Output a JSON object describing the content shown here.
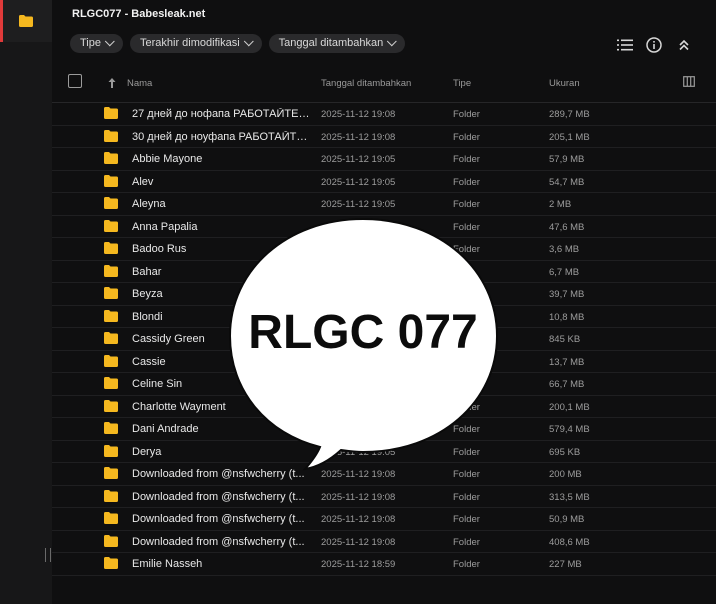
{
  "window": {
    "title": "RLGC077 - Babesleak.net"
  },
  "filters": [
    {
      "label": "Tipe"
    },
    {
      "label": "Terakhir dimodifikasi"
    },
    {
      "label": "Tanggal ditambahkan"
    }
  ],
  "toolbar_icons": [
    "list-view-icon",
    "info-icon",
    "collapse-icon"
  ],
  "table": {
    "columns": {
      "name": "Nama",
      "date": "Tanggal ditambahkan",
      "type": "Tipe",
      "size": "Ukuran"
    },
    "rows": [
      {
        "name": "27 дней до нофапа РАБОТАЙТЕ Б...",
        "date": "2025-11-12 19:08",
        "type": "Folder",
        "size": "289,7 MB"
      },
      {
        "name": "30 дней до ноуфапа РАБОТАЙТЕ ...",
        "date": "2025-11-12 19:08",
        "type": "Folder",
        "size": "205,1 MB"
      },
      {
        "name": "Abbie Mayone",
        "date": "2025-11-12 19:05",
        "type": "Folder",
        "size": "57,9 MB"
      },
      {
        "name": "Alev",
        "date": "2025-11-12 19:05",
        "type": "Folder",
        "size": "54,7 MB"
      },
      {
        "name": "Aleyna",
        "date": "2025-11-12 19:05",
        "type": "Folder",
        "size": "2 MB"
      },
      {
        "name": "Anna Papalia",
        "date": "",
        "type": "Folder",
        "size": "47,6 MB"
      },
      {
        "name": "Badoo Rus",
        "date": "",
        "type": "Folder",
        "size": "3,6 MB"
      },
      {
        "name": "Bahar",
        "date": "",
        "type": "",
        "size": "6,7 MB"
      },
      {
        "name": "Beyza",
        "date": "",
        "type": "",
        "size": "39,7 MB"
      },
      {
        "name": "Blondi",
        "date": "",
        "type": "",
        "size": "10,8 MB"
      },
      {
        "name": "Cassidy Green",
        "date": "",
        "type": "",
        "size": "845 KB"
      },
      {
        "name": "Cassie",
        "date": "",
        "type": "",
        "size": "13,7 MB"
      },
      {
        "name": "Celine Sin",
        "date": "",
        "type": "",
        "size": "66,7 MB"
      },
      {
        "name": "Charlotte Wayment",
        "date": "",
        "type": "Folder",
        "size": "200,1 MB"
      },
      {
        "name": "Dani Andrade",
        "date": "",
        "type": "Folder",
        "size": "579,4 MB"
      },
      {
        "name": "Derya",
        "date": "2025-11-12 19:05",
        "type": "Folder",
        "size": "695 KB"
      },
      {
        "name": "Downloaded from @nsfwcherry (t...",
        "date": "2025-11-12 19:08",
        "type": "Folder",
        "size": "200 MB"
      },
      {
        "name": "Downloaded from @nsfwcherry (t...",
        "date": "2025-11-12 19:08",
        "type": "Folder",
        "size": "313,5 MB"
      },
      {
        "name": "Downloaded from @nsfwcherry (t...",
        "date": "2025-11-12 19:08",
        "type": "Folder",
        "size": "50,9 MB"
      },
      {
        "name": "Downloaded from @nsfwcherry (t...",
        "date": "2025-11-12 19:08",
        "type": "Folder",
        "size": "408,6 MB"
      },
      {
        "name": "Emilie Nasseh",
        "date": "2025-11-12 18:59",
        "type": "Folder",
        "size": "227 MB"
      }
    ]
  },
  "overlay": {
    "text": "RLGC 077"
  },
  "colors": {
    "accent": "#e03a3a",
    "folder": "#f5b81f",
    "background": "#0f0f10"
  }
}
